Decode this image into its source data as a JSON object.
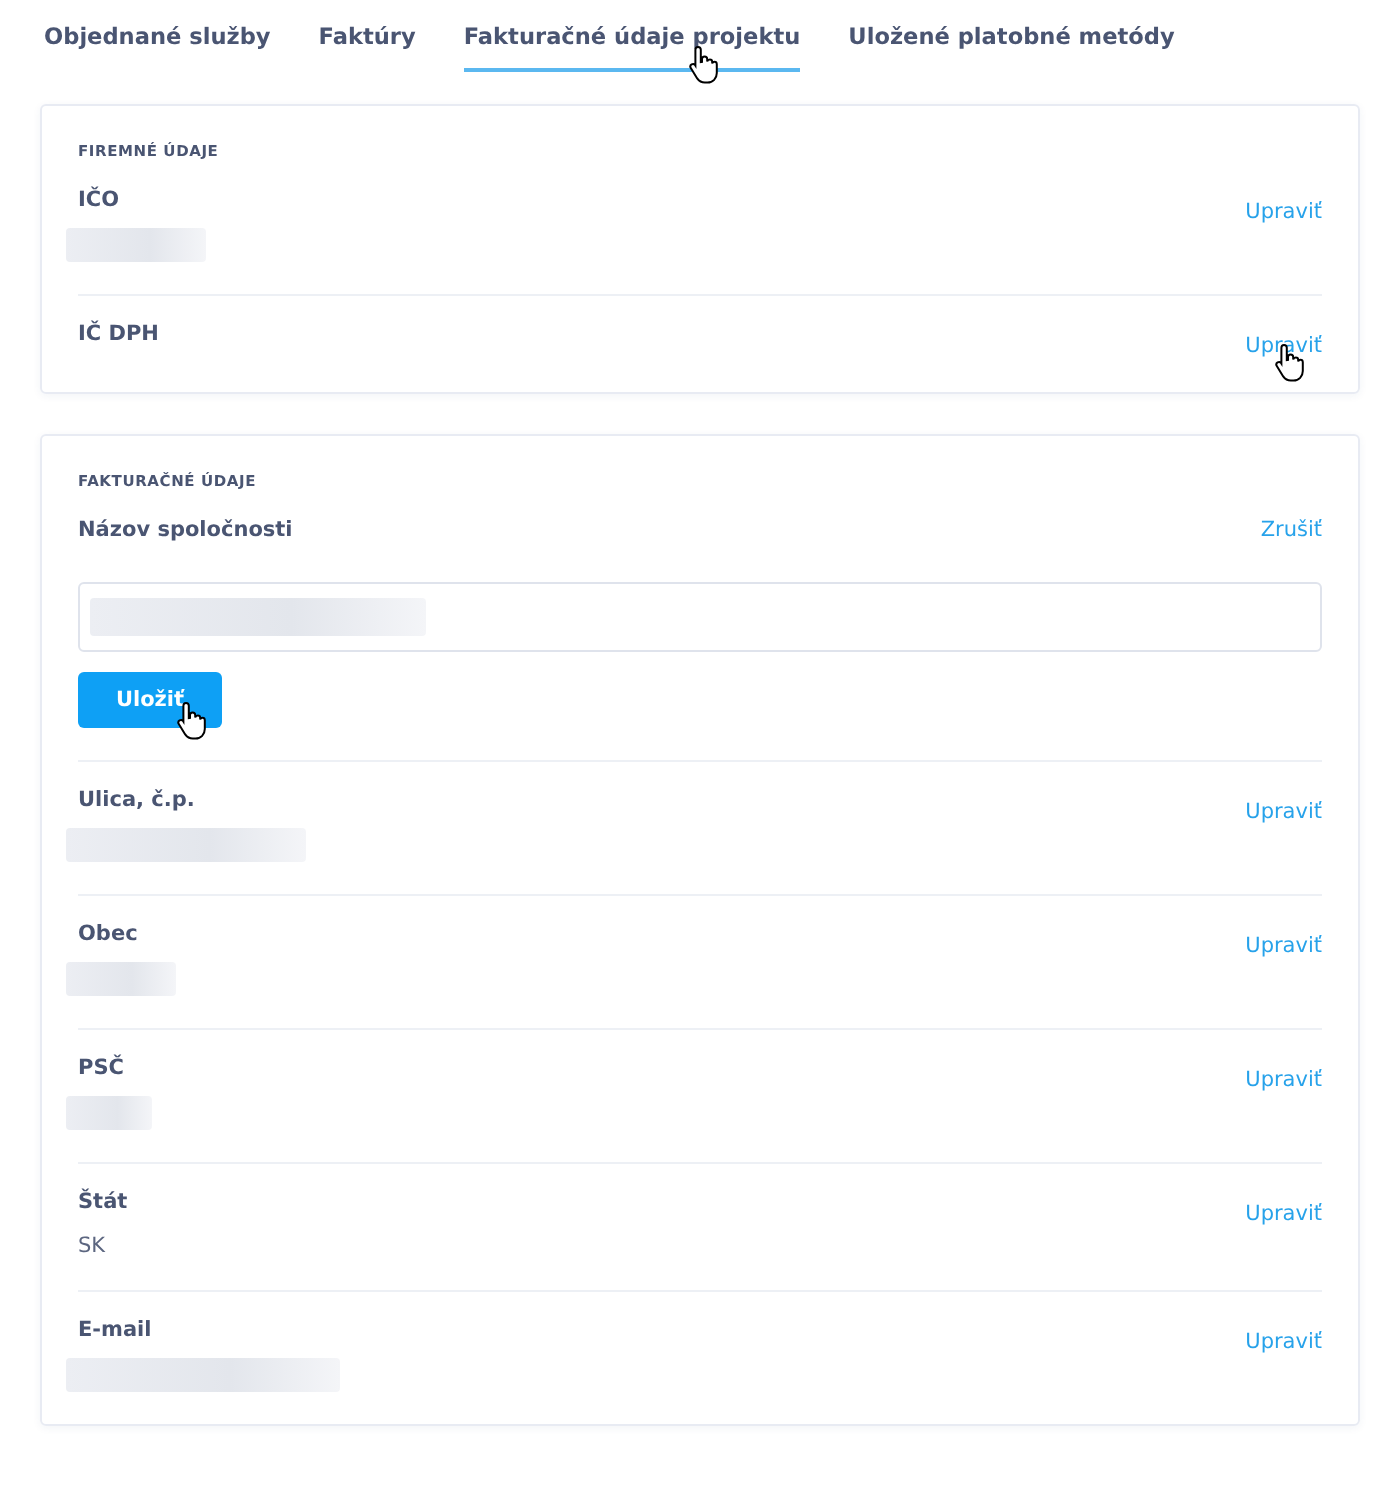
{
  "tabs": [
    {
      "label": "Objednané služby",
      "selected": false,
      "cursor": false
    },
    {
      "label": "Faktúry",
      "selected": false,
      "cursor": false
    },
    {
      "label": "Fakturačné údaje projektu",
      "selected": true,
      "cursor": true
    },
    {
      "label": "Uložené platobné metódy",
      "selected": false,
      "cursor": false
    }
  ],
  "sections": [
    {
      "heading": "FIREMNÉ ÚDAJE",
      "rows": [
        {
          "kind": "display",
          "label": "IČO",
          "value_hidden": true,
          "action": "Upraviť",
          "cursor": false
        },
        {
          "kind": "display",
          "label": "IČ DPH",
          "value_hidden": false,
          "action": "Upraviť",
          "cursor": true
        }
      ]
    },
    {
      "heading": "FAKTURAČNÉ ÚDAJE",
      "rows": [
        {
          "kind": "editing",
          "label": "Názov spoločnosti",
          "action": "Zrušiť",
          "value_hidden": true,
          "save_label": "Uložiť",
          "save_cursor": true
        },
        {
          "kind": "display",
          "label": "Ulica, č.p.",
          "value_hidden": true,
          "action": "Upraviť",
          "cursor": false
        },
        {
          "kind": "display",
          "label": "Obec",
          "value_hidden": true,
          "action": "Upraviť",
          "cursor": false
        },
        {
          "kind": "display",
          "label": "PSČ",
          "value_hidden": true,
          "action": "Upraviť",
          "cursor": false
        },
        {
          "kind": "display",
          "label": "Štát",
          "value": "SK",
          "action": "Upraviť",
          "cursor": false
        },
        {
          "kind": "display",
          "label": "E-mail",
          "value_hidden": true,
          "action": "Upraviť",
          "cursor": false
        }
      ]
    }
  ]
}
